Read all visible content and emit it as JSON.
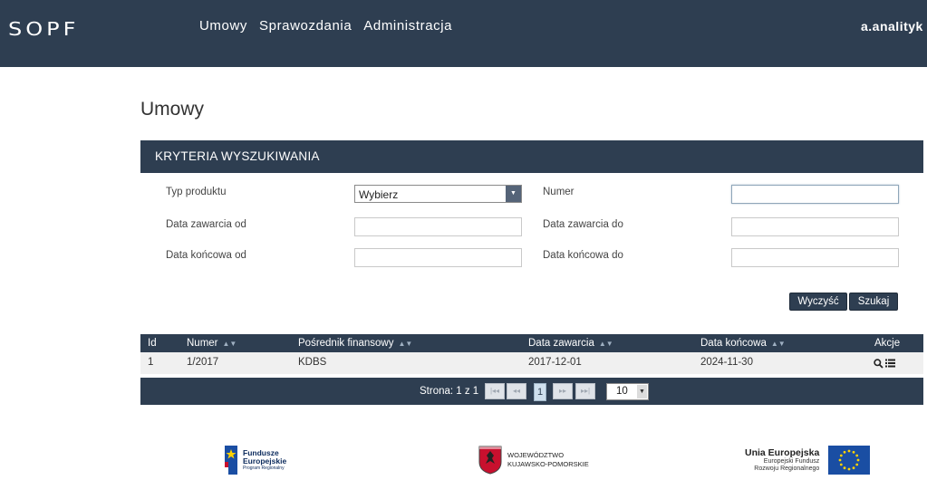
{
  "header": {
    "logo_text": "SOPF",
    "nav": [
      "Umowy",
      "Sprawozdania",
      "Administracja"
    ],
    "user": "a.analityk"
  },
  "page": {
    "title": "Umowy"
  },
  "criteria": {
    "title": "KRYTERIA WYSZUKIWANIA",
    "product_type_label": "Typ produktu",
    "product_type_value": "Wybierz",
    "number_label": "Numer",
    "number_value": "",
    "date_concluded_from_label": "Data zawarcia od",
    "date_concluded_to_label": "Data zawarcia do",
    "end_date_from_label": "Data końcowa od",
    "end_date_to_label": "Data końcowa do",
    "clear_label": "Wyczyść",
    "search_label": "Szukaj"
  },
  "table": {
    "columns": [
      "Id",
      "Numer",
      "Pośrednik finansowy",
      "Data zawarcia",
      "Data końcowa",
      "Akcje"
    ],
    "rows": [
      [
        "1",
        "1/2017",
        "KDBS",
        "2017-12-01",
        "2024-11-30"
      ]
    ]
  },
  "pager": {
    "info": "Strona: 1 z 1",
    "first": "|◂◂",
    "prev": "◂◂",
    "current": "1",
    "next": "▸▸",
    "last": "▸▸|",
    "page_size": "10"
  },
  "footer": {
    "fe_line1": "Fundusze",
    "fe_line2": "Europejskie",
    "fe_line3": "Program Regionalny",
    "wkp_line1": "WOJEWÓDZTWO",
    "wkp_line2": "KUJAWSKO-POMORSKIE",
    "ue_title": "Unia Europejska",
    "ue_line1": "Europejski Fundusz",
    "ue_line2": "Rozwoju Regionalnego"
  },
  "colors": {
    "navy": "#2e3e51",
    "eu_blue": "#1a4ea3",
    "eu_gold": "#ffd200",
    "wkp_red": "#c8102e"
  }
}
